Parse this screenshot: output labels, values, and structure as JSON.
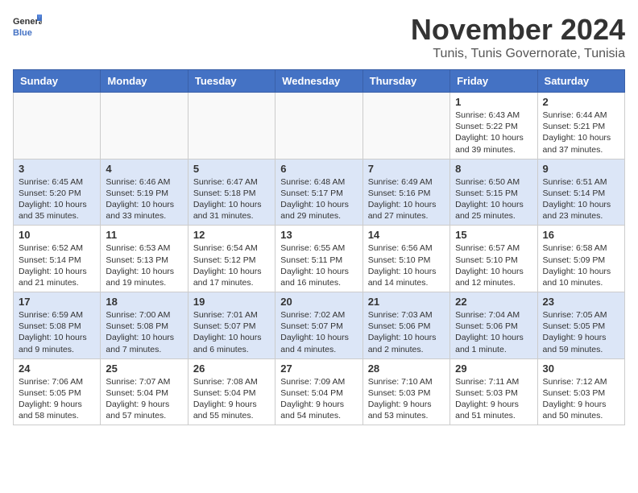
{
  "logo": {
    "line1": "General",
    "line2": "Blue"
  },
  "title": "November 2024",
  "location": "Tunis, Tunis Governorate, Tunisia",
  "headers": [
    "Sunday",
    "Monday",
    "Tuesday",
    "Wednesday",
    "Thursday",
    "Friday",
    "Saturday"
  ],
  "weeks": [
    [
      {
        "day": "",
        "info": ""
      },
      {
        "day": "",
        "info": ""
      },
      {
        "day": "",
        "info": ""
      },
      {
        "day": "",
        "info": ""
      },
      {
        "day": "",
        "info": ""
      },
      {
        "day": "1",
        "info": "Sunrise: 6:43 AM\nSunset: 5:22 PM\nDaylight: 10 hours and 39 minutes."
      },
      {
        "day": "2",
        "info": "Sunrise: 6:44 AM\nSunset: 5:21 PM\nDaylight: 10 hours and 37 minutes."
      }
    ],
    [
      {
        "day": "3",
        "info": "Sunrise: 6:45 AM\nSunset: 5:20 PM\nDaylight: 10 hours and 35 minutes."
      },
      {
        "day": "4",
        "info": "Sunrise: 6:46 AM\nSunset: 5:19 PM\nDaylight: 10 hours and 33 minutes."
      },
      {
        "day": "5",
        "info": "Sunrise: 6:47 AM\nSunset: 5:18 PM\nDaylight: 10 hours and 31 minutes."
      },
      {
        "day": "6",
        "info": "Sunrise: 6:48 AM\nSunset: 5:17 PM\nDaylight: 10 hours and 29 minutes."
      },
      {
        "day": "7",
        "info": "Sunrise: 6:49 AM\nSunset: 5:16 PM\nDaylight: 10 hours and 27 minutes."
      },
      {
        "day": "8",
        "info": "Sunrise: 6:50 AM\nSunset: 5:15 PM\nDaylight: 10 hours and 25 minutes."
      },
      {
        "day": "9",
        "info": "Sunrise: 6:51 AM\nSunset: 5:14 PM\nDaylight: 10 hours and 23 minutes."
      }
    ],
    [
      {
        "day": "10",
        "info": "Sunrise: 6:52 AM\nSunset: 5:14 PM\nDaylight: 10 hours and 21 minutes."
      },
      {
        "day": "11",
        "info": "Sunrise: 6:53 AM\nSunset: 5:13 PM\nDaylight: 10 hours and 19 minutes."
      },
      {
        "day": "12",
        "info": "Sunrise: 6:54 AM\nSunset: 5:12 PM\nDaylight: 10 hours and 17 minutes."
      },
      {
        "day": "13",
        "info": "Sunrise: 6:55 AM\nSunset: 5:11 PM\nDaylight: 10 hours and 16 minutes."
      },
      {
        "day": "14",
        "info": "Sunrise: 6:56 AM\nSunset: 5:10 PM\nDaylight: 10 hours and 14 minutes."
      },
      {
        "day": "15",
        "info": "Sunrise: 6:57 AM\nSunset: 5:10 PM\nDaylight: 10 hours and 12 minutes."
      },
      {
        "day": "16",
        "info": "Sunrise: 6:58 AM\nSunset: 5:09 PM\nDaylight: 10 hours and 10 minutes."
      }
    ],
    [
      {
        "day": "17",
        "info": "Sunrise: 6:59 AM\nSunset: 5:08 PM\nDaylight: 10 hours and 9 minutes."
      },
      {
        "day": "18",
        "info": "Sunrise: 7:00 AM\nSunset: 5:08 PM\nDaylight: 10 hours and 7 minutes."
      },
      {
        "day": "19",
        "info": "Sunrise: 7:01 AM\nSunset: 5:07 PM\nDaylight: 10 hours and 6 minutes."
      },
      {
        "day": "20",
        "info": "Sunrise: 7:02 AM\nSunset: 5:07 PM\nDaylight: 10 hours and 4 minutes."
      },
      {
        "day": "21",
        "info": "Sunrise: 7:03 AM\nSunset: 5:06 PM\nDaylight: 10 hours and 2 minutes."
      },
      {
        "day": "22",
        "info": "Sunrise: 7:04 AM\nSunset: 5:06 PM\nDaylight: 10 hours and 1 minute."
      },
      {
        "day": "23",
        "info": "Sunrise: 7:05 AM\nSunset: 5:05 PM\nDaylight: 9 hours and 59 minutes."
      }
    ],
    [
      {
        "day": "24",
        "info": "Sunrise: 7:06 AM\nSunset: 5:05 PM\nDaylight: 9 hours and 58 minutes."
      },
      {
        "day": "25",
        "info": "Sunrise: 7:07 AM\nSunset: 5:04 PM\nDaylight: 9 hours and 57 minutes."
      },
      {
        "day": "26",
        "info": "Sunrise: 7:08 AM\nSunset: 5:04 PM\nDaylight: 9 hours and 55 minutes."
      },
      {
        "day": "27",
        "info": "Sunrise: 7:09 AM\nSunset: 5:04 PM\nDaylight: 9 hours and 54 minutes."
      },
      {
        "day": "28",
        "info": "Sunrise: 7:10 AM\nSunset: 5:03 PM\nDaylight: 9 hours and 53 minutes."
      },
      {
        "day": "29",
        "info": "Sunrise: 7:11 AM\nSunset: 5:03 PM\nDaylight: 9 hours and 51 minutes."
      },
      {
        "day": "30",
        "info": "Sunrise: 7:12 AM\nSunset: 5:03 PM\nDaylight: 9 hours and 50 minutes."
      }
    ]
  ]
}
